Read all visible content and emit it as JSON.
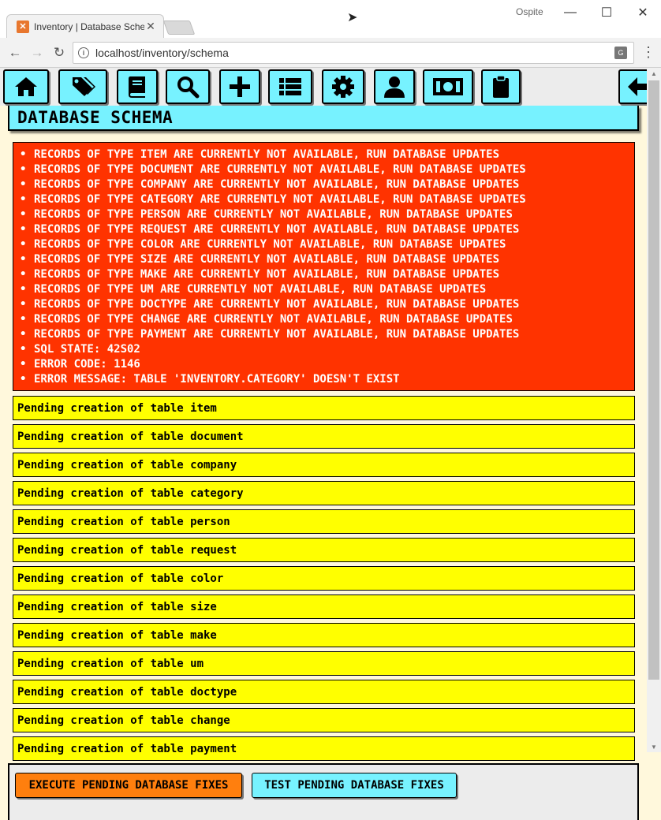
{
  "browser": {
    "tab_title": "Inventory | Database Schema",
    "tab_favicon": "xampp-icon",
    "close_glyph": "✕",
    "profile_name": "Ospite",
    "url": "localhost/inventory/schema",
    "window_controls": {
      "minimize": "—",
      "maximize": "☐",
      "close": "✕"
    },
    "nav": {
      "back": "←",
      "forward": "→",
      "reload": "↻",
      "menu": "⋮"
    }
  },
  "toolbar": {
    "buttons": [
      {
        "name": "home-icon"
      },
      {
        "name": "tags-icon"
      },
      {
        "name": "book-icon"
      },
      {
        "name": "search-icon"
      },
      {
        "name": "plus-icon"
      },
      {
        "name": "list-icon"
      },
      {
        "name": "gear-icon"
      },
      {
        "name": "user-icon"
      },
      {
        "name": "money-icon"
      },
      {
        "name": "clipboard-icon"
      },
      {
        "name": "arrow-left-icon"
      }
    ]
  },
  "page": {
    "title": "DATABASE SCHEMA"
  },
  "errors": {
    "bullet": "•",
    "lines": [
      "RECORDS OF TYPE ITEM ARE CURRENTLY NOT AVAILABLE, RUN DATABASE UPDATES",
      "RECORDS OF TYPE DOCUMENT ARE CURRENTLY NOT AVAILABLE, RUN DATABASE UPDATES",
      "RECORDS OF TYPE COMPANY ARE CURRENTLY NOT AVAILABLE, RUN DATABASE UPDATES",
      "RECORDS OF TYPE CATEGORY ARE CURRENTLY NOT AVAILABLE, RUN DATABASE UPDATES",
      "RECORDS OF TYPE PERSON ARE CURRENTLY NOT AVAILABLE, RUN DATABASE UPDATES",
      "RECORDS OF TYPE REQUEST ARE CURRENTLY NOT AVAILABLE, RUN DATABASE UPDATES",
      "RECORDS OF TYPE COLOR ARE CURRENTLY NOT AVAILABLE, RUN DATABASE UPDATES",
      "RECORDS OF TYPE SIZE ARE CURRENTLY NOT AVAILABLE, RUN DATABASE UPDATES",
      "RECORDS OF TYPE MAKE ARE CURRENTLY NOT AVAILABLE, RUN DATABASE UPDATES",
      "RECORDS OF TYPE UM ARE CURRENTLY NOT AVAILABLE, RUN DATABASE UPDATES",
      "RECORDS OF TYPE DOCTYPE ARE CURRENTLY NOT AVAILABLE, RUN DATABASE UPDATES",
      "RECORDS OF TYPE CHANGE ARE CURRENTLY NOT AVAILABLE, RUN DATABASE UPDATES",
      "RECORDS OF TYPE PAYMENT ARE CURRENTLY NOT AVAILABLE, RUN DATABASE UPDATES",
      "SQL STATE: 42S02",
      "ERROR CODE: 1146",
      "ERROR MESSAGE: TABLE 'INVENTORY.CATEGORY' DOESN'T EXIST"
    ]
  },
  "pending": [
    "Pending creation of table item",
    "Pending creation of table document",
    "Pending creation of table company",
    "Pending creation of table category",
    "Pending creation of table person",
    "Pending creation of table request",
    "Pending creation of table color",
    "Pending creation of table size",
    "Pending creation of table make",
    "Pending creation of table um",
    "Pending creation of table doctype",
    "Pending creation of table change",
    "Pending creation of table payment"
  ],
  "actions": {
    "execute_label": "EXECUTE PENDING DATABASE FIXES",
    "test_label": "TEST PENDING DATABASE FIXES"
  },
  "colors": {
    "toolbar_button": "#77f2ff",
    "error_background": "#ff3300",
    "pending_background": "#ffff00",
    "execute_button": "#ff7f0e",
    "test_button": "#77f2ff",
    "page_background": "#fff8dc"
  }
}
